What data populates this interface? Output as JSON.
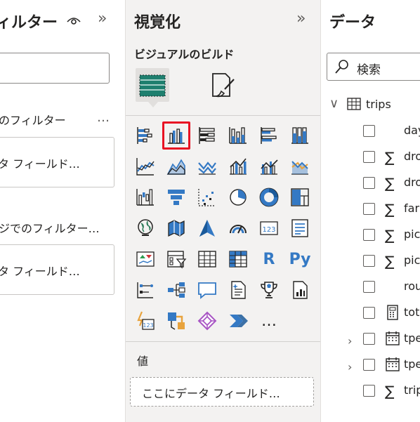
{
  "filters": {
    "title": "ィルター",
    "collapse_glyph": "»",
    "section_page": "のフィルター",
    "more_glyph": "…",
    "well_page": "タ フィールド…",
    "section_all": "ジでのフィルター…",
    "well_all": "タ フィールド…"
  },
  "viz": {
    "title": "視覚化",
    "collapse_glyph": "»",
    "build_label": "ビジュアルのビルド",
    "values_label": "値",
    "drop_placeholder": "ここにデータ フィールド…",
    "text_icons": {
      "r": "R",
      "py": "Py",
      "more": "…"
    },
    "selected_icon": "clustered-column-chart-icon",
    "accent": "#3479c4",
    "selection_color": "#e81123"
  },
  "data": {
    "title": "データ",
    "search_placeholder": "検索",
    "table_name": "trips",
    "fields": [
      {
        "name": "day",
        "icon": "none"
      },
      {
        "name": "dro",
        "icon": "sigma"
      },
      {
        "name": "dro",
        "icon": "sigma"
      },
      {
        "name": "far",
        "icon": "sigma"
      },
      {
        "name": "pic",
        "icon": "sigma"
      },
      {
        "name": "pic",
        "icon": "sigma"
      },
      {
        "name": "rou",
        "icon": "none"
      },
      {
        "name": "tot",
        "icon": "calculator"
      },
      {
        "name": "tpe",
        "icon": "calendar",
        "expandable": true
      },
      {
        "name": "tpe",
        "icon": "calendar",
        "expandable": true
      },
      {
        "name": "trip",
        "icon": "sigma"
      }
    ]
  }
}
